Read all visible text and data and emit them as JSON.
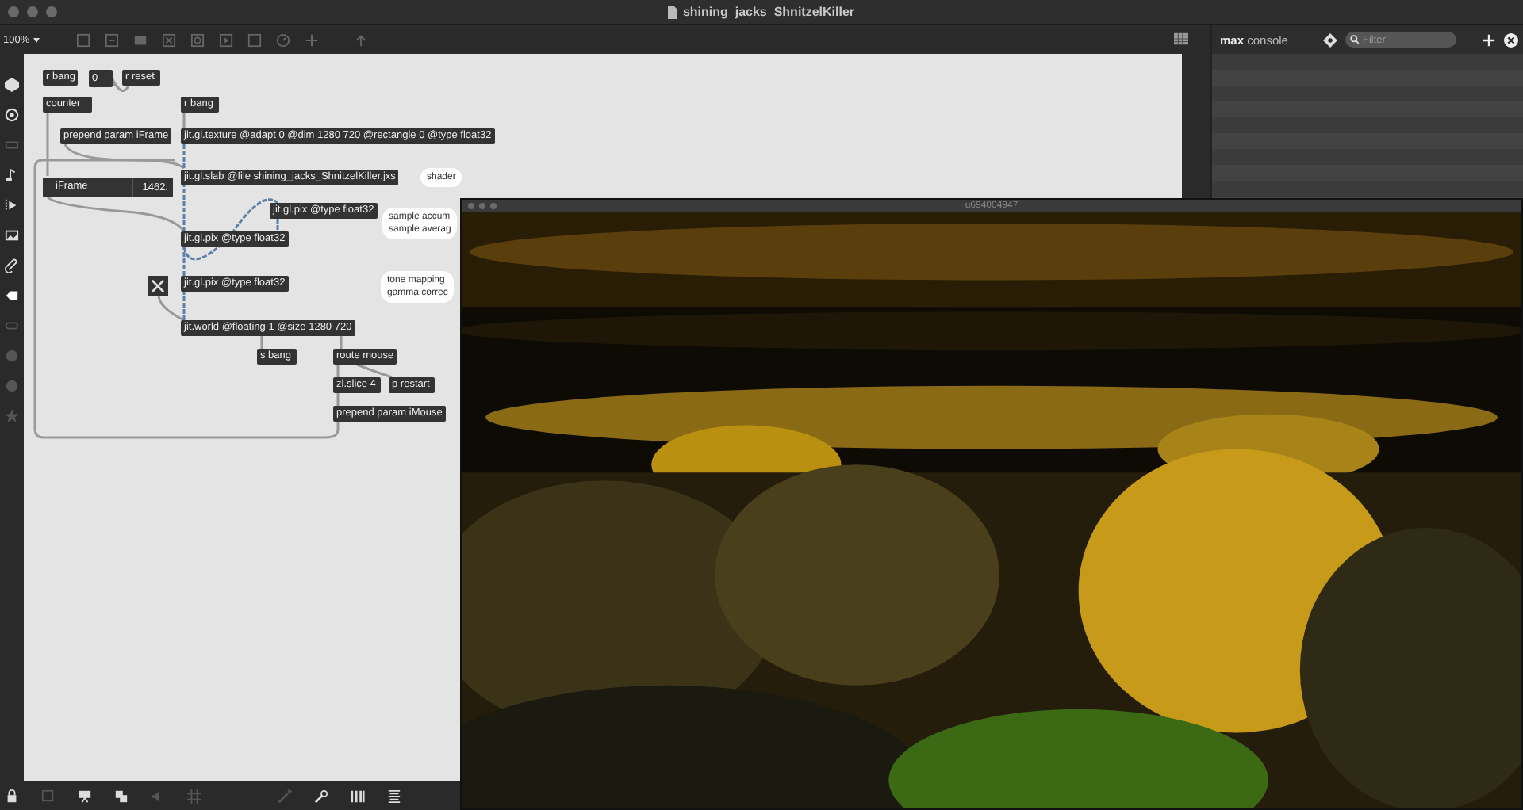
{
  "window": {
    "title": "shining_jacks_ShnitzelKiller"
  },
  "toolbar": {
    "zoom": "100%"
  },
  "patcher": {
    "objects": [
      {
        "kind": "object",
        "text": "r bang"
      },
      {
        "kind": "number",
        "text": "0"
      },
      {
        "kind": "object",
        "text": "r reset"
      },
      {
        "kind": "object",
        "text": "counter"
      },
      {
        "kind": "object",
        "text": "r bang"
      },
      {
        "kind": "object",
        "text": "prepend param iFrame"
      },
      {
        "kind": "object",
        "text": "jit.gl.texture @adapt 0 @dim 1280 720 @rectangle 0 @type float32"
      },
      {
        "kind": "object",
        "text": "jit.gl.slab @file shining_jacks_ShnitzelKiller.jxs"
      },
      {
        "kind": "comment",
        "lines": [
          "shader"
        ]
      },
      {
        "kind": "flonum",
        "label": "iFrame",
        "text": "1462."
      },
      {
        "kind": "object",
        "text": "jit.gl.pix @type float32"
      },
      {
        "kind": "comment",
        "lines": [
          "sample accum",
          "sample averag"
        ]
      },
      {
        "kind": "object",
        "text": "jit.gl.pix @type float32"
      },
      {
        "kind": "toggle",
        "checked": true
      },
      {
        "kind": "object",
        "text": "jit.gl.pix @type float32"
      },
      {
        "kind": "comment",
        "lines": [
          "tone mapping",
          "gamma correc"
        ]
      },
      {
        "kind": "object",
        "text": "jit.world @floating 1 @size 1280 720"
      },
      {
        "kind": "object",
        "text": "s bang"
      },
      {
        "kind": "object",
        "text": "route mouse"
      },
      {
        "kind": "object",
        "text": "zl.slice 4"
      },
      {
        "kind": "object",
        "text": "p restart"
      },
      {
        "kind": "object",
        "text": "prepend param iMouse"
      }
    ]
  },
  "console": {
    "title": "**max** console",
    "filter": {
      "placeholder": "Filter"
    }
  },
  "render_window": {
    "title": "u694004947"
  }
}
